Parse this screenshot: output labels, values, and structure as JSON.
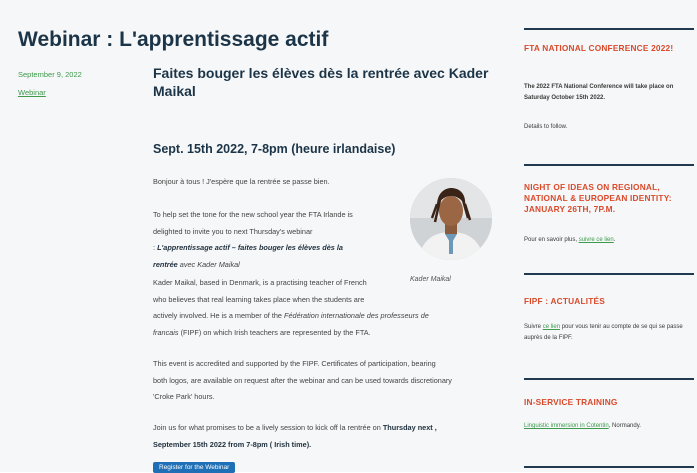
{
  "page_title": "Webinar : L'apprentissage actif",
  "meta": {
    "date": "September 9, 2022",
    "category": "Webinar"
  },
  "article": {
    "heading": "Faites bouger les élèves dès la rentrée avec Kader Maikal",
    "subheading": "Sept. 15th 2022, 7-8pm (heure irlandaise)",
    "p1": "Bonjour à tous ! J'espère que la rentrée se passe bien.",
    "p2_line1": "To help set the tone for the new school year the FTA Irlande is",
    "p2_line2": "delighted to invite you to next Thursday's webinar",
    "p2_prefix": ": ",
    "p2_title_a": "L'apprentissage actif – faites bouger les élèves dès la",
    "p2_title_b": "rentrée",
    "p2_with": " avec Kader Maikal",
    "caption": "Kader Maikal",
    "p3_line1": "Kader Maikal, based in Denmark, is a practising teacher of French",
    "p3_line2": "who believes that real learning takes place when the students are",
    "p3_line3a": "actively involved. He is a member of the ",
    "p3_line3b": "Fédération internationale des professeurs de",
    "p3_line4a": "francais",
    "p3_line4b": " (FIPF) on which Irish teachers are represented by the FTA.",
    "p4_line1": "This event is accredited and supported by the FIPF. Certificates of participation, bearing",
    "p4_line2": "both logos, are available on request after the webinar and can be used towards discretionary",
    "p4_line3": "'Croke Park' hours.",
    "p5_line1a": "Join us for what promises to be a lively session to kick off la rentrée on ",
    "p5_line1b": "Thursday next ,",
    "p5_line2": "September 15th 2022 from 7-8pm ( Irish time).",
    "register_label": "Register for the Webinar"
  },
  "sidebar": {
    "w1_title": "FTA NATIONAL CONFERENCE 2022!",
    "w1_text": "The 2022 FTA National Conference will take place on Saturday October 15th 2022.",
    "w1_note": "Details to follow.",
    "w2_title": "NIGHT OF IDEAS ON REGIONAL, NATIONAL & EUROPEAN IDENTITY: JANUARY 26TH, 7P.M.",
    "w2_text_a": "Pour en savoir plus, ",
    "w2_link": "suivre ce lien",
    "w2_text_b": ".",
    "w3_title": "FIPF : ACTUALITÉS",
    "w3_text_a": "Suivre ",
    "w3_link": "ce lien",
    "w3_text_b": " pour vous tenir au compte de se qui se passe auprès de la FIPF.",
    "w4_title": "IN-SERVICE TRAINING",
    "w4_link": "Linguistic immersion in Cotentin",
    "w4_text_b": ", Normandy."
  }
}
